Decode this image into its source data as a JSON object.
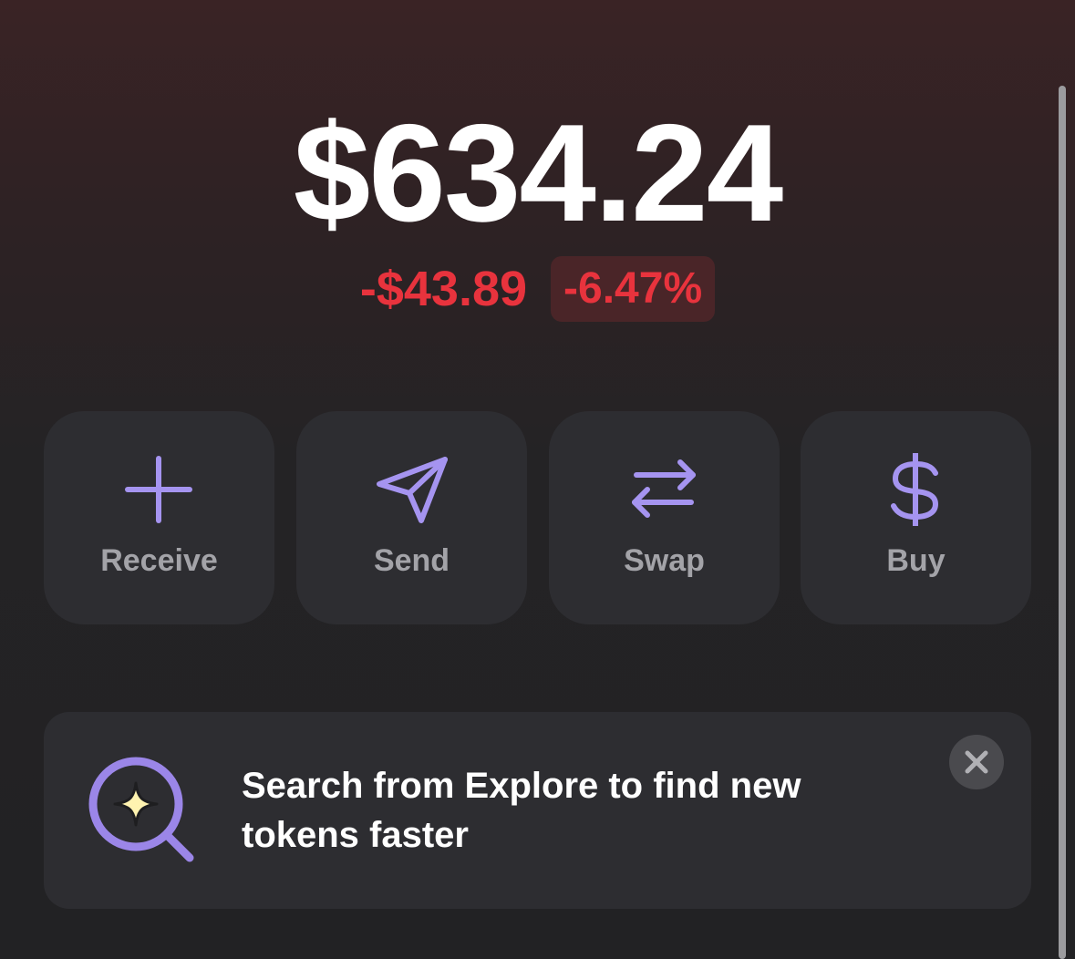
{
  "portfolio": {
    "balance": "$634.24",
    "change_amount": "-$43.89",
    "change_percent": "-6.47%",
    "change_color": "#e8333d"
  },
  "actions": [
    {
      "label": "Receive",
      "icon": "plus-icon"
    },
    {
      "label": "Send",
      "icon": "send-icon"
    },
    {
      "label": "Swap",
      "icon": "swap-icon"
    },
    {
      "label": "Buy",
      "icon": "dollar-icon"
    }
  ],
  "banner": {
    "text": "Search from Explore to find new tokens faster",
    "icon": "explore-search-icon",
    "close_icon": "close-icon"
  },
  "colors": {
    "accent": "#a594f0",
    "card": "#2d2d31",
    "negative": "#e8333d",
    "sparkle": "#fff3b0"
  }
}
